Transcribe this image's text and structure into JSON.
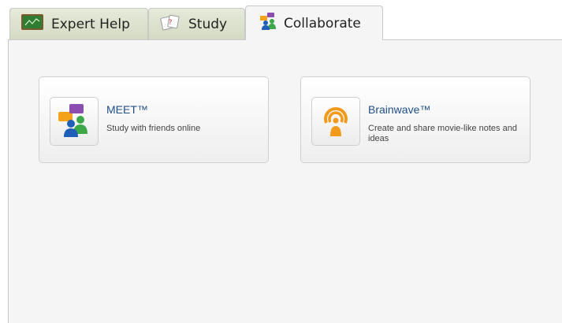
{
  "tabs": [
    {
      "label": "Expert Help",
      "icon": "chalkboard-icon",
      "active": false
    },
    {
      "label": "Study",
      "icon": "flashcards-icon",
      "active": false
    },
    {
      "label": "Collaborate",
      "icon": "people-chat-icon",
      "active": true
    }
  ],
  "cards": [
    {
      "title": "MEET™",
      "description": "Study with friends online",
      "icon": "meet-people-chat-icon"
    },
    {
      "title": "Brainwave™",
      "description": "Create and share movie-like notes and ideas",
      "icon": "brainwave-broadcast-icon"
    }
  ],
  "colors": {
    "tab_inactive": "#d9dfc9",
    "panel_bg": "#f5f5f5",
    "card_title": "#1f4f86",
    "brainwave_orange": "#f39a1a"
  }
}
